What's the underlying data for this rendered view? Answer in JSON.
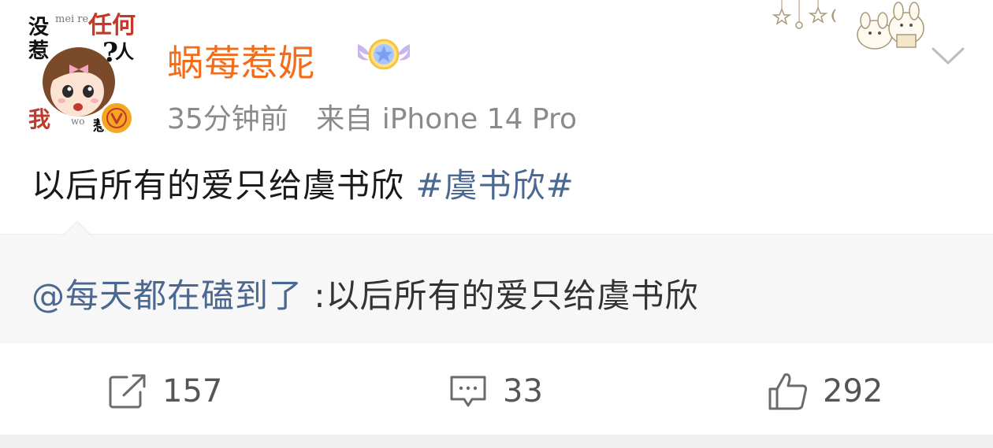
{
  "post": {
    "author": {
      "name": "蜗莓惹妮",
      "avatar_texts": [
        "没",
        "惹",
        "任何",
        "人",
        "我",
        "mei re",
        "wo",
        "惹你",
        "?"
      ]
    },
    "time": "35分钟前",
    "source": "来自 iPhone 14 Pro",
    "text": "以后所有的爱只给虞书欣",
    "hashtag": "#虞书欣#",
    "repost": {
      "mention": "@每天都在磕到了",
      "text": ":以后所有的爱只给虞书欣"
    },
    "actions": {
      "repost_count": "157",
      "comment_count": "33",
      "like_count": "292"
    }
  },
  "colors": {
    "username": "#f26c1a",
    "link": "#4a6891",
    "meta": "#8a8a8a",
    "repost_bg": "#f7f7f7",
    "verify_badge": "#f5a623"
  },
  "icons": [
    "verified-v-icon",
    "vip-star-wing-badge",
    "decorative-stars-bunny",
    "chevron-down-icon",
    "repost-icon",
    "comment-icon",
    "like-icon"
  ]
}
